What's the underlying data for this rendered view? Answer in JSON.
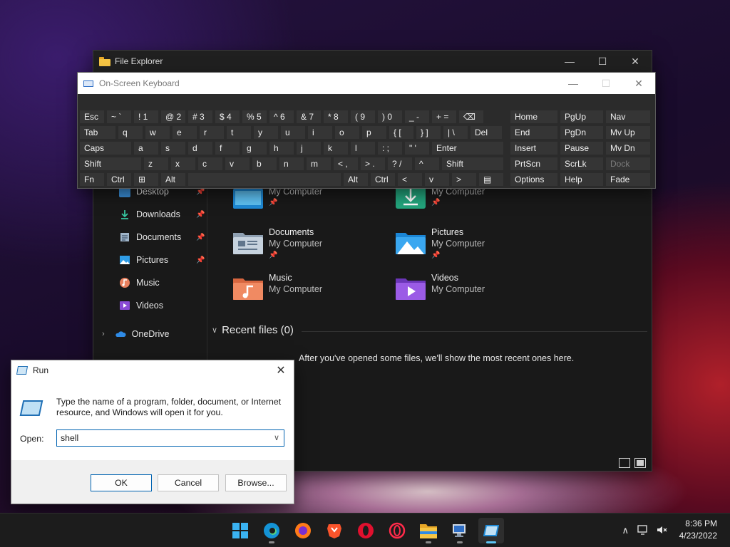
{
  "file_explorer": {
    "title": "File Explorer",
    "nav": {
      "items": [
        {
          "label": "Desktop",
          "icon": "desktop-icon"
        },
        {
          "label": "Downloads",
          "icon": "download-icon"
        },
        {
          "label": "Documents",
          "icon": "documents-icon"
        },
        {
          "label": "Pictures",
          "icon": "pictures-icon"
        },
        {
          "label": "Music",
          "icon": "music-icon"
        },
        {
          "label": "Videos",
          "icon": "videos-icon"
        }
      ],
      "onedrive": "OneDrive"
    },
    "quick_access": [
      {
        "name": "",
        "location": "My Computer",
        "icon": "desktop-folder-icon"
      },
      {
        "name": "",
        "location": "My Computer",
        "icon": "downloads-folder-icon"
      },
      {
        "name": "Documents",
        "location": "My Computer",
        "icon": "documents-folder-icon"
      },
      {
        "name": "Pictures",
        "location": "My Computer",
        "icon": "pictures-folder-icon"
      },
      {
        "name": "Music",
        "location": "My Computer",
        "icon": "music-folder-icon"
      },
      {
        "name": "Videos",
        "location": "My Computer",
        "icon": "videos-folder-icon"
      }
    ],
    "recent_header": "Recent files (0)",
    "recent_empty": "After you've opened some files, we'll show the most recent ones here."
  },
  "osk": {
    "title": "On-Screen Keyboard",
    "rows": [
      [
        "Esc",
        "~ `",
        "! 1",
        "@ 2",
        "# 3",
        "$ 4",
        "% 5",
        "^ 6",
        "& 7",
        "* 8",
        "( 9",
        ") 0",
        "_ -",
        "+ =",
        "⌫",
        "Home",
        "PgUp",
        "Nav"
      ],
      [
        "Tab",
        "q",
        "w",
        "e",
        "r",
        "t",
        "y",
        "u",
        "i",
        "o",
        "p",
        "{ [",
        "} ]",
        "| \\",
        "Del",
        "End",
        "PgDn",
        "Mv Up"
      ],
      [
        "Caps",
        "a",
        "s",
        "d",
        "f",
        "g",
        "h",
        "j",
        "k",
        "l",
        ": ;",
        "\" '",
        "Enter",
        "Insert",
        "Pause",
        "Mv Dn"
      ],
      [
        "Shift",
        "z",
        "x",
        "c",
        "v",
        "b",
        "n",
        "m",
        "< ,",
        "> .",
        "? /",
        "^",
        "Shift",
        "PrtScn",
        "ScrLk",
        "Dock"
      ],
      [
        "Fn",
        "Ctrl",
        "⊞",
        "Alt",
        "",
        "Alt",
        "Ctrl",
        "<",
        "v",
        ">",
        "▤",
        "Options",
        "Help",
        "Fade"
      ]
    ]
  },
  "run_dialog": {
    "title": "Run",
    "description": "Type the name of a program, folder, document, or Internet resource, and Windows will open it for you.",
    "open_label": "Open:",
    "input_value": "shell",
    "ok": "OK",
    "cancel": "Cancel",
    "browse": "Browse..."
  },
  "taskbar": {
    "apps": [
      "start-icon",
      "edge-icon",
      "firefox-icon",
      "brave-icon",
      "opera-icon",
      "opera-gx-icon",
      "file-explorer-icon",
      "remote-desktop-icon",
      "run-icon"
    ],
    "time": "8:36 PM",
    "date": "4/23/2022"
  }
}
